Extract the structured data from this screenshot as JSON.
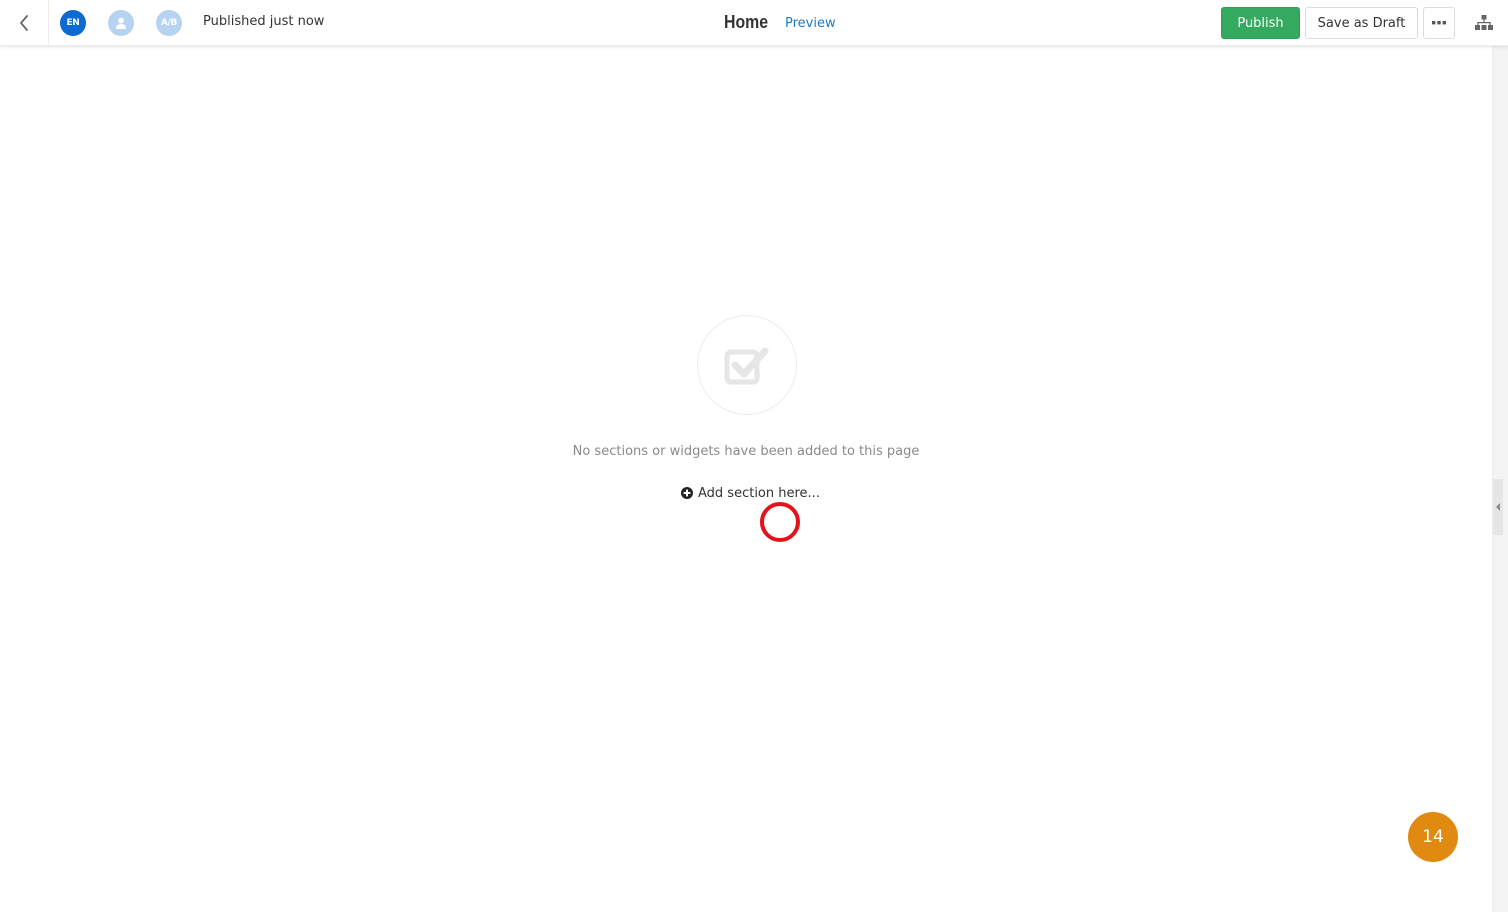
{
  "header": {
    "back_icon": "chevron-left-icon",
    "avatars": [
      {
        "label": "EN",
        "kind": "language",
        "color": "#0d6ad1"
      },
      {
        "label": "",
        "kind": "user",
        "icon": "user-icon",
        "color": "#b7d3f2"
      },
      {
        "label": "A/B",
        "kind": "ab-test",
        "color": "#b7d3f2"
      }
    ],
    "status": "Published just now",
    "title": "Home",
    "preview_label": "Preview",
    "publish_label": "Publish",
    "save_draft_label": "Save as Draft",
    "more_icon": "ellipsis-icon",
    "sitemap_icon": "sitemap-icon"
  },
  "colors": {
    "publish": "#35a95f",
    "link": "#1e7ac7",
    "badge": "#e08a11",
    "click_marker": "#e3121b"
  },
  "canvas": {
    "empty_icon": "checkbox-checked-icon",
    "empty_message": "No sections or widgets have been added to this page",
    "add_section_label": "Add section here...",
    "add_icon": "plus-circle-icon"
  },
  "badge": {
    "count": "14"
  }
}
